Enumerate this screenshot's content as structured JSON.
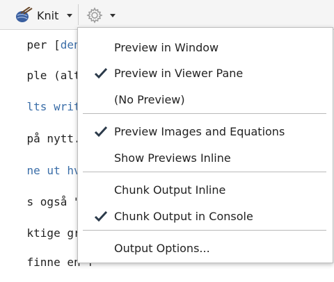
{
  "toolbar": {
    "knit_label": "Knit"
  },
  "editor_lines": [
    {
      "prefix": "per [",
      "highlight": "denne",
      "rest": ""
    },
    {
      "prefix": "ple (altså",
      "highlight": "",
      "rest": ""
    },
    {
      "prefix": "",
      "highlight": "lts write",
      "rest": ""
    },
    {
      "prefix": "på nytt.",
      "highlight": "",
      "rest": ""
    },
    {
      "prefix": "",
      "highlight": "ne ut hvil",
      "rest": ""
    },
    {
      "prefix": "s også \"ka",
      "highlight": "",
      "rest": ""
    },
    {
      "prefix": "ktige grun",
      "highlight": "",
      "rest": ""
    },
    {
      "prefix": "finne en f",
      "highlight": "",
      "rest": ""
    },
    {
      "prefix": "",
      "highlight": "",
      "rest": ""
    }
  ],
  "menu": {
    "items": [
      {
        "label": "Preview in Window",
        "checked": false
      },
      {
        "label": "Preview in Viewer Pane",
        "checked": true
      },
      {
        "label": "(No Preview)",
        "checked": false
      },
      {
        "label": "Preview Images and Equations",
        "checked": true
      },
      {
        "label": "Show Previews Inline",
        "checked": false
      },
      {
        "label": "Chunk Output Inline",
        "checked": false
      },
      {
        "label": "Chunk Output in Console",
        "checked": true
      },
      {
        "label": "Output Options...",
        "checked": false
      }
    ]
  },
  "colors": {
    "accent": "#3b6ea8",
    "check": "#2b3a4a"
  }
}
